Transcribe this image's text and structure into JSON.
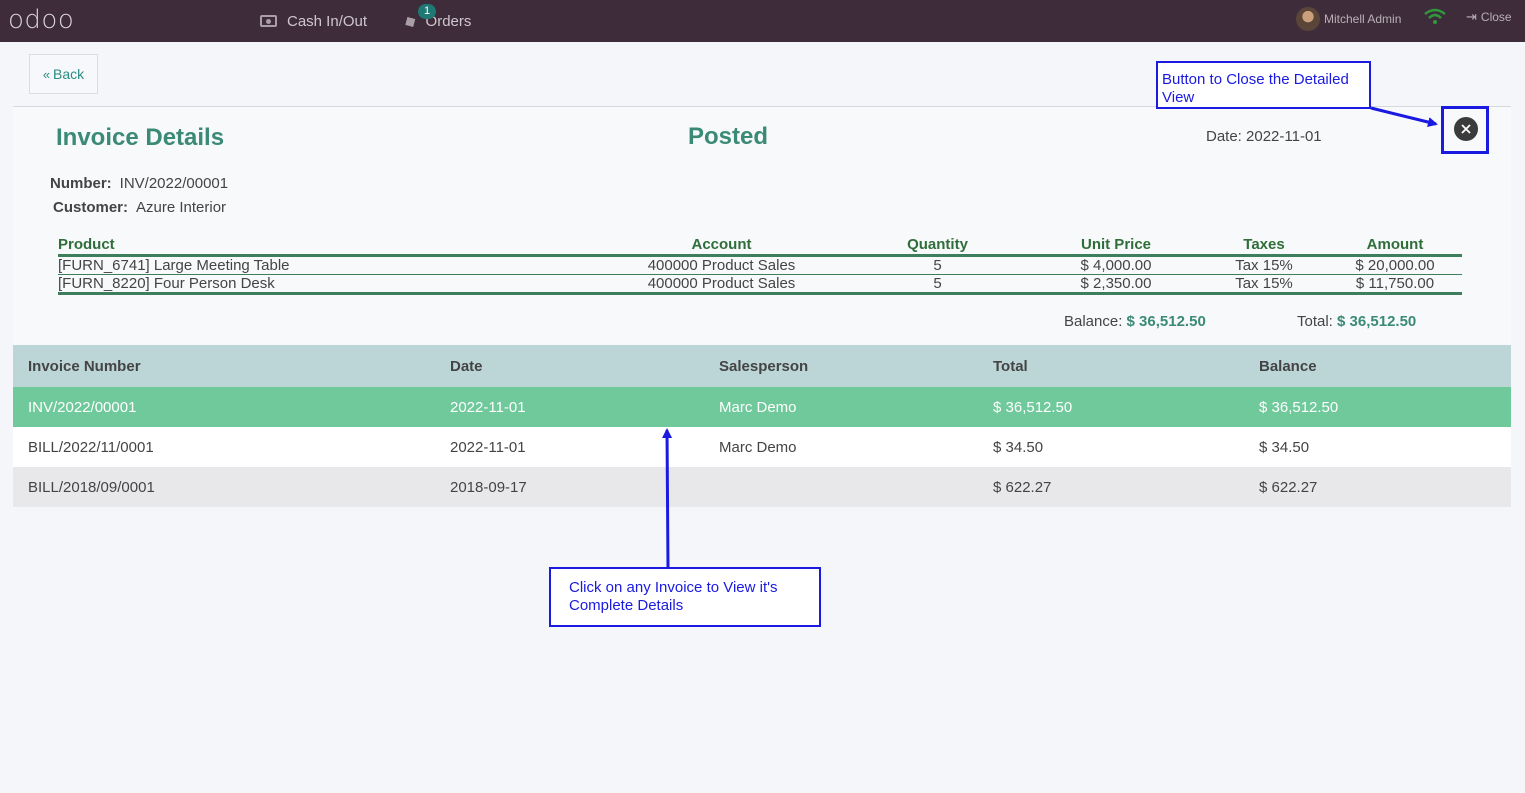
{
  "topbar": {
    "logo": "odoo",
    "cash_label": "Cash In/Out",
    "orders_label": "Orders",
    "orders_badge": "1",
    "user_name": "Mitchell Admin",
    "close_label": "Close"
  },
  "back_label": "Back",
  "details": {
    "title": "Invoice Details",
    "state": "Posted",
    "date_text": "Date: 2022-11-01",
    "number_label": "Number:",
    "number_value": "INV/2022/00001",
    "customer_label": "Customer:",
    "customer_value": "Azure Interior",
    "columns": [
      "Product",
      "Account",
      "Quantity",
      "Unit Price",
      "Taxes",
      "Amount"
    ],
    "lines": [
      {
        "product": "[FURN_6741] Large Meeting Table",
        "account": "400000 Product Sales",
        "quantity": "5",
        "unit_price": "$ 4,000.00",
        "taxes": "Tax 15%",
        "amount": "$ 20,000.00"
      },
      {
        "product": "[FURN_8220] Four Person Desk",
        "account": "400000 Product Sales",
        "quantity": "5",
        "unit_price": "$ 2,350.00",
        "taxes": "Tax 15%",
        "amount": "$ 11,750.00"
      }
    ],
    "balance_label": "Balance:",
    "balance_value": "$ 36,512.50",
    "total_label": "Total:",
    "total_value": "$ 36,512.50"
  },
  "invoice_list": {
    "columns": [
      "Invoice Number",
      "Date",
      "Salesperson",
      "Total",
      "Balance"
    ],
    "rows": [
      {
        "number": "INV/2022/00001",
        "date": "2022-11-01",
        "salesperson": "Marc Demo",
        "total": "$ 36,512.50",
        "balance": "$ 36,512.50"
      },
      {
        "number": "BILL/2022/11/0001",
        "date": "2022-11-01",
        "salesperson": "Marc Demo",
        "total": "$ 34.50",
        "balance": "$ 34.50"
      },
      {
        "number": "BILL/2018/09/0001",
        "date": "2018-09-17",
        "salesperson": "",
        "total": "$ 622.27",
        "balance": "$ 622.27"
      }
    ]
  },
  "annotations": {
    "close_note": "Button to Close the Detailed View",
    "click_note": "Click on any Invoice to View it's Complete Details"
  },
  "colors": {
    "topbar": "#3e2c3a",
    "accent_green": "#3a8a76",
    "selected_row": "#6fc99b",
    "header_row": "#bcd6d8",
    "annotation_blue": "#1a1ae0"
  }
}
